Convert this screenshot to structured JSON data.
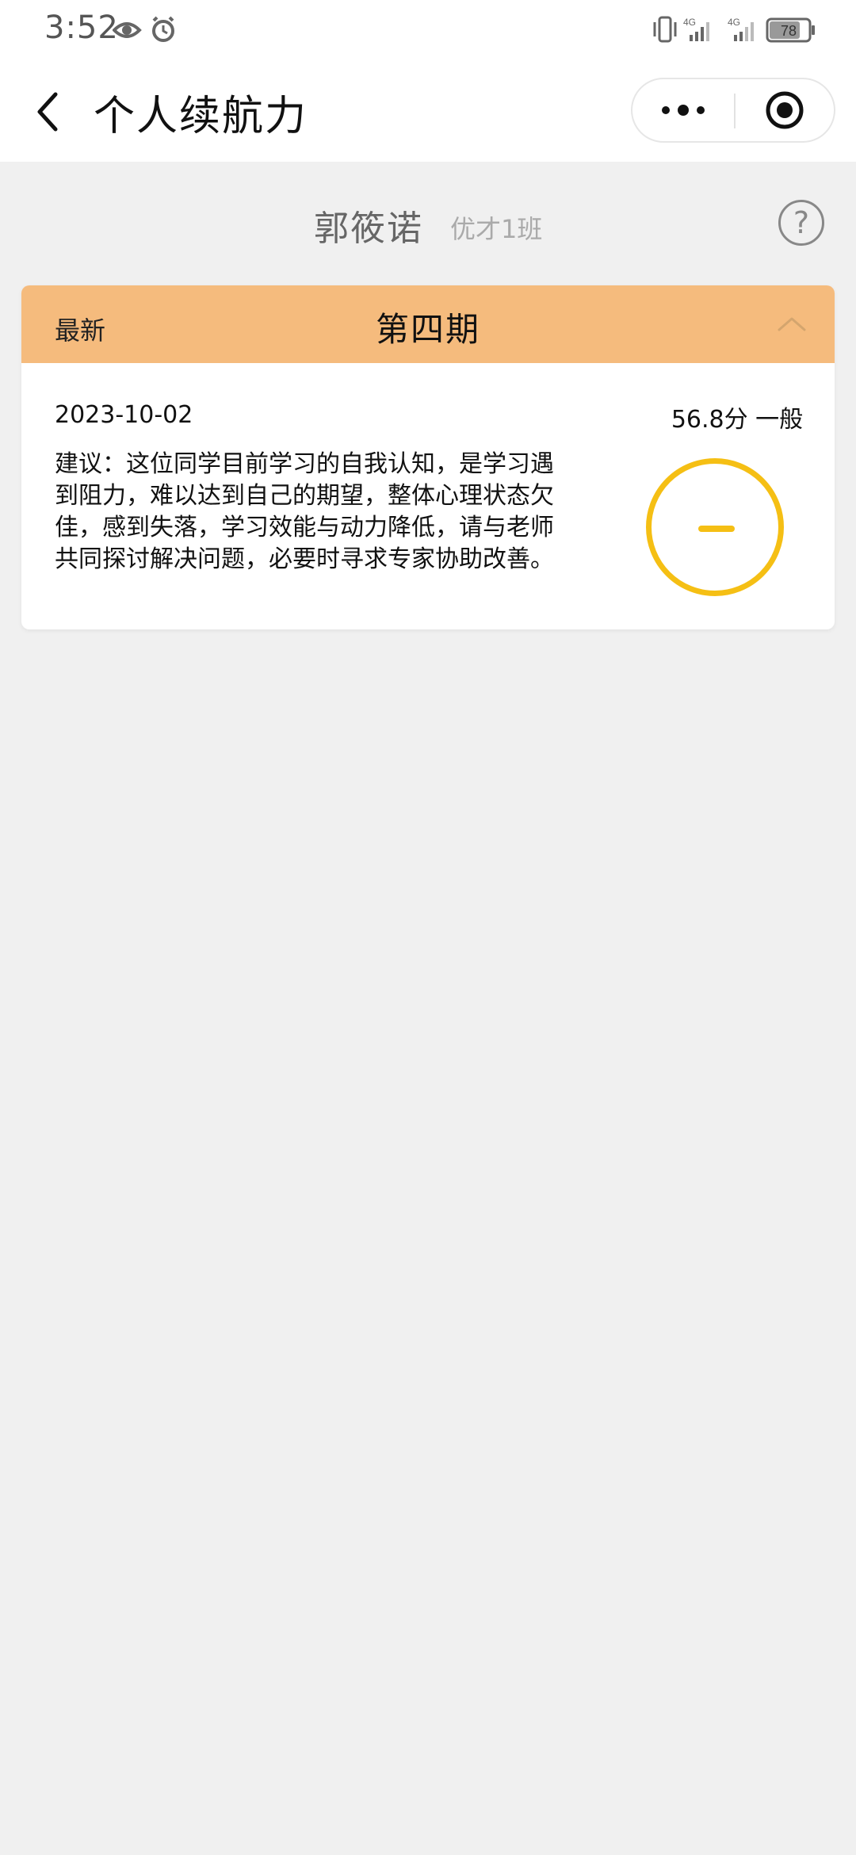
{
  "status_bar": {
    "time": "3:52",
    "battery": "78",
    "signal_1": "4G",
    "signal_2": "4G",
    "icons": [
      "eye-icon",
      "alarm-icon",
      "vibrate-icon",
      "signal-icon",
      "battery-icon"
    ]
  },
  "nav": {
    "title": "个人续航力",
    "icons": [
      "back-icon",
      "more-icon",
      "target-icon"
    ]
  },
  "student": {
    "name": "郭筱诺",
    "class": "优才1班",
    "help_symbol": "?"
  },
  "card": {
    "latest_label": "最新",
    "period_title": "第四期",
    "date": "2023-10-02",
    "score_text": "56.8分 一般",
    "suggestion": "建议：这位同学目前学习的自我认知，是学习遇到阻力，难以达到自己的期望，整体心理状态欠佳，感到失落，学习效能与动力降低，请与老师共同探讨解决问题，必要时寻求专家协助改善。",
    "status_icon": "neutral-minus-icon"
  },
  "colors": {
    "header_bg": "#f5bb7d",
    "status_ring": "#f5bf14",
    "page_bg": "#f0f0f0"
  }
}
